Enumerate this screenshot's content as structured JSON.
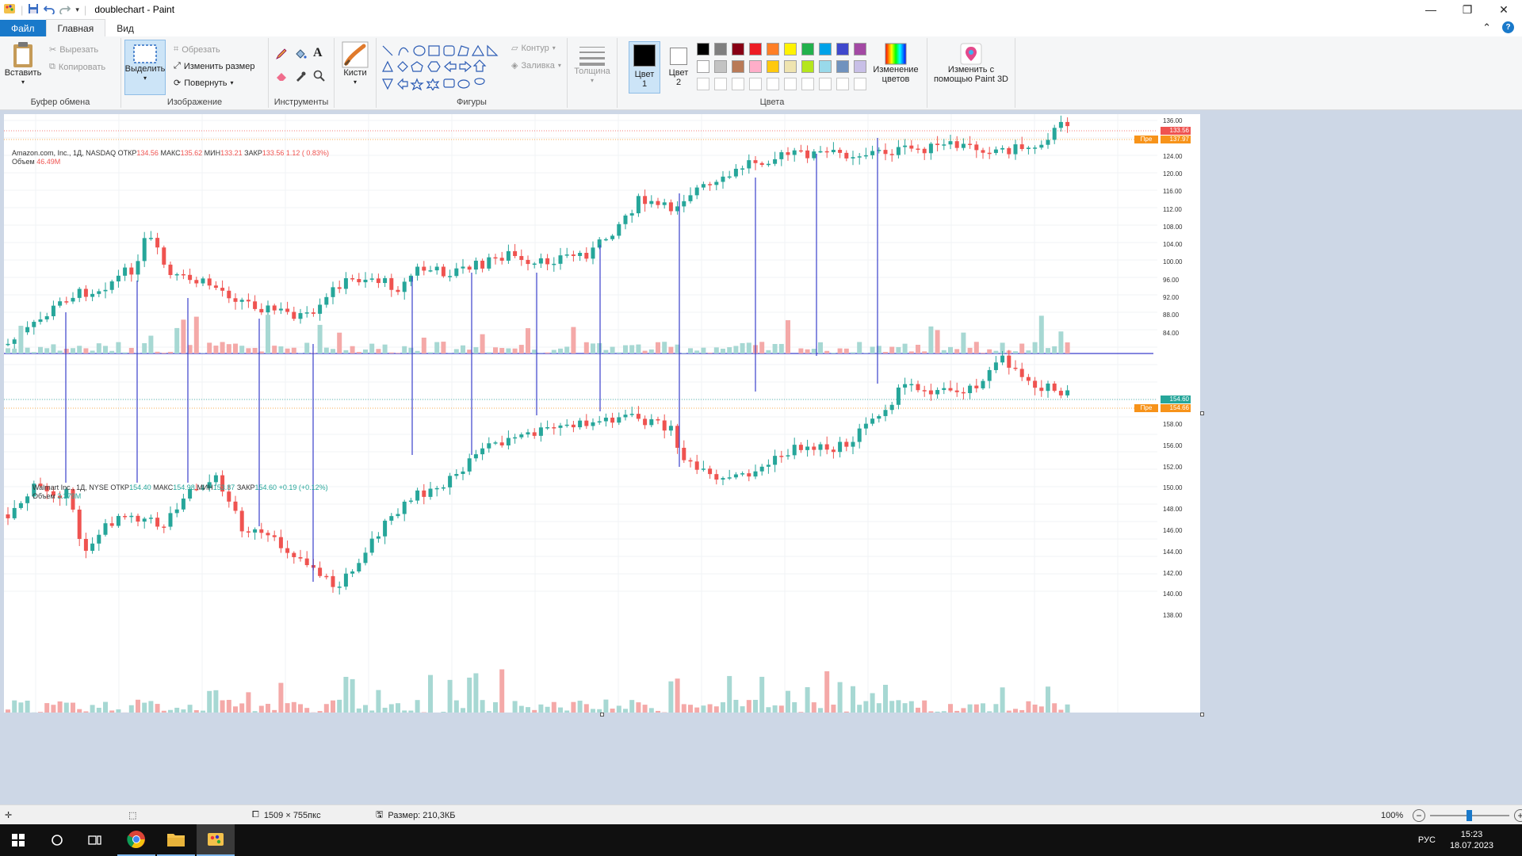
{
  "window": {
    "title": "doublechart - Paint"
  },
  "tabs": {
    "file": "Файл",
    "home": "Главная",
    "view": "Вид"
  },
  "ribbon": {
    "clipboard": {
      "paste": "Вставить",
      "cut": "Вырезать",
      "copy": "Копировать",
      "label": "Буфер обмена"
    },
    "image": {
      "select": "Выделить",
      "crop": "Обрезать",
      "resize": "Изменить размер",
      "rotate": "Повернуть",
      "label": "Изображение"
    },
    "tools": {
      "label": "Инструменты"
    },
    "brushes": {
      "label": "Кисти"
    },
    "shapes": {
      "outline": "Контур",
      "fill": "Заливка",
      "label": "Фигуры"
    },
    "thickness": {
      "label": "Толщина"
    },
    "colors": {
      "color1": "Цвет",
      "color1_num": "1",
      "color2": "Цвет",
      "color2_num": "2",
      "edit": "Изменение цветов",
      "paint3d": "Изменить с помощью Paint 3D",
      "label": "Цвета",
      "row1": [
        "#000000",
        "#7f7f7f",
        "#880015",
        "#ed1c24",
        "#ff7f27",
        "#fff200",
        "#22b14c",
        "#00a2e8",
        "#3f48cc",
        "#a349a4"
      ],
      "row2": [
        "#ffffff",
        "#c3c3c3",
        "#b97a57",
        "#ffaec9",
        "#ffc90e",
        "#efe4b0",
        "#b5e61d",
        "#99d9ea",
        "#7092be",
        "#c8bfe7"
      ]
    }
  },
  "chart_top": {
    "legend": {
      "name": "Amazon.com, Inc., 1Д, NASDAQ",
      "open_label": "ОТКР",
      "open": "134.56",
      "high_label": "МАКС",
      "high": "135.62",
      "low_label": "МИН",
      "low": "133.21",
      "close_label": "ЗАКР",
      "close": "133.56",
      "change": "1.12 ( 0.83%)",
      "volume_label": "Объем",
      "volume": "46.49M"
    },
    "ticks": [
      "136.00",
      "128.00",
      "124.00",
      "120.00",
      "116.00",
      "112.00",
      "108.00",
      "104.00",
      "100.00",
      "96.00",
      "92.00",
      "88.00",
      "84.00"
    ],
    "price_badge": "133.56",
    "pre_badge_label": "Пре",
    "pre_badge": "137.97"
  },
  "chart_bottom": {
    "legend": {
      "name": "Walmart Inc., 1Д, NYSE",
      "open_label": "ОТКР",
      "open": "154.40",
      "high_label": "МАКС",
      "high": "154.98",
      "low_label": "МИН",
      "low": "153.87",
      "close_label": "ЗАКР",
      "close": "154.60",
      "change": "+0.19 (+0.12%)",
      "volume_label": "Объем",
      "volume": "3.379M"
    },
    "ticks": [
      "158.00",
      "156.00",
      "152.00",
      "150.00",
      "148.00",
      "146.00",
      "144.00",
      "142.00",
      "140.00",
      "138.00"
    ],
    "price_badge": "154.60",
    "pre_badge_label": "Пре",
    "pre_badge": "154.66"
  },
  "colors": {
    "up": "#26a69a",
    "down": "#ef5350",
    "vol_up": "#a7d8d3",
    "vol_down": "#f4a9a8",
    "guide": "#3a3fcc",
    "workspace": "#cdd7e6",
    "accent": "#1979ca"
  },
  "statusbar": {
    "dimensions": "1509 × 755пкс",
    "size": "Размер: 210,3КБ",
    "zoom": "100%"
  },
  "taskbar": {
    "lang": "РУС",
    "time": "15:23",
    "date": "18.07.2023"
  }
}
